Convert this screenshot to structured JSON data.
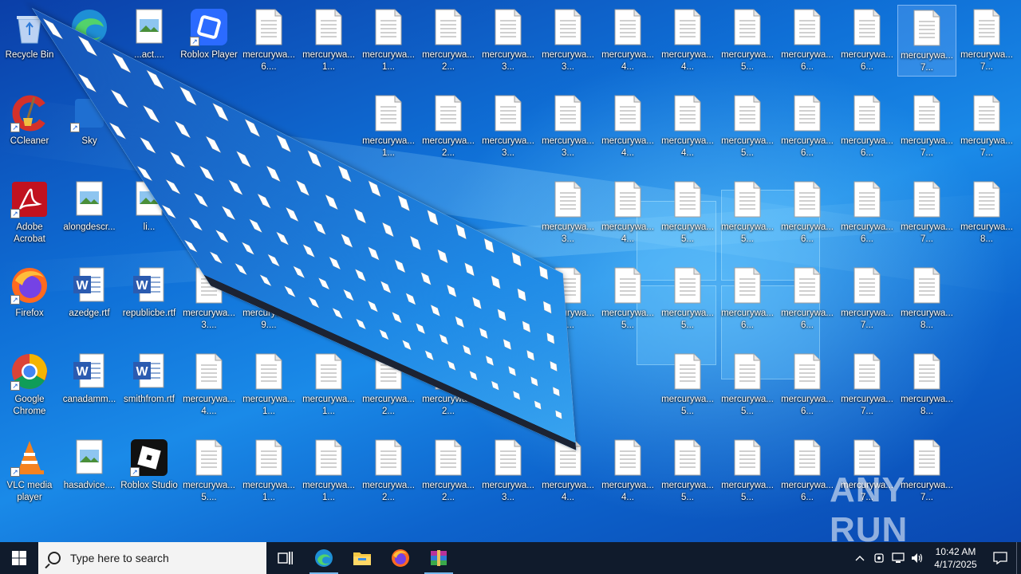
{
  "desktop": {
    "icons_col0": [
      {
        "label": "Recycle Bin",
        "type": "recycle"
      },
      {
        "label": "CCleaner",
        "type": "ccleaner"
      },
      {
        "label": "Adobe Acrobat",
        "type": "acrobat"
      },
      {
        "label": "Firefox",
        "type": "firefox"
      },
      {
        "label": "Google Chrome",
        "type": "chrome"
      },
      {
        "label": "VLC media player",
        "type": "vlc"
      }
    ],
    "icons_col1": [
      {
        "label": "",
        "type": "edge"
      },
      {
        "label": "Sky",
        "type": "generic"
      },
      {
        "label": "alongdescr...",
        "type": "image"
      },
      {
        "label": "azedge.rtf",
        "type": "word"
      },
      {
        "label": "canadamm...",
        "type": "word"
      },
      {
        "label": "hasadvice....",
        "type": "image"
      }
    ],
    "icons_col2": [
      {
        "label": "...act....",
        "type": "image"
      },
      {
        "label": "",
        "type": "none"
      },
      {
        "label": "li...",
        "type": "image"
      },
      {
        "label": "republicbe.rtf",
        "type": "word"
      },
      {
        "label": "smithfrom.rtf",
        "type": "word"
      },
      {
        "label": "Roblox Studio",
        "type": "roblox-studio"
      }
    ],
    "roblox_player_label": "Roblox Player",
    "doc_rows": [
      [
        "mercurywa... 6....",
        "mercurywa... 1...",
        "mercurywa... 1...",
        "mercurywa... 2...",
        "mercurywa... 3...",
        "mercurywa... 3...",
        "mercurywa... 4...",
        "mercurywa... 4...",
        "mercurywa... 5...",
        "mercurywa... 6...",
        "mercurywa... 6...",
        "mercurywa... 7...",
        "mercurywa... 7..."
      ],
      [
        "",
        "",
        "mercurywa... 1...",
        "mercurywa... 2...",
        "mercurywa... 3...",
        "mercurywa... 3...",
        "mercurywa... 4...",
        "mercurywa... 4...",
        "mercurywa... 5...",
        "mercurywa... 6...",
        "mercurywa... 6...",
        "mercurywa... 7...",
        "mercurywa... 7..."
      ],
      [
        "",
        "",
        "",
        "",
        "",
        "mercurywa... 3...",
        "mercurywa... 4...",
        "mercurywa... 5...",
        "mercurywa... 5...",
        "mercurywa... 6...",
        "mercurywa... 6...",
        "mercurywa... 7...",
        "mercurywa... 8..."
      ],
      [
        "mercurywa... 3....",
        "mercurywa... 9....",
        "",
        "",
        "",
        "",
        "mercurywa... 4...",
        "mercurywa... 5...",
        "mercurywa... 5...",
        "mercurywa... 6...",
        "mercurywa... 6...",
        "mercurywa... 7...",
        "mercurywa... 8..."
      ],
      [
        "mercurywa... 4....",
        "mercurywa... 1...",
        "mercurywa... 1...",
        "mercurywa... 2...",
        "mercurywa... 2...",
        "mercurywa... 3...",
        "",
        "",
        "mercurywa... 5...",
        "mercurywa... 5...",
        "mercurywa... 6...",
        "mercurywa... 7...",
        "mercurywa... 8..."
      ],
      [
        "mercurywa... 5....",
        "mercurywa... 1...",
        "mercurywa... 1...",
        "mercurywa... 2...",
        "mercurywa... 2...",
        "mercurywa... 3...",
        "mercurywa... 4...",
        "mercurywa... 4...",
        "mercurywa... 5...",
        "mercurywa... 5...",
        "mercurywa... 6...",
        "mercurywa... 7...",
        "mercurywa... 7..."
      ]
    ],
    "extra_last_row": "mercurywa... 8..."
  },
  "taskbar": {
    "search_placeholder": "Type here to search",
    "time": "10:42 AM",
    "date": "4/17/2025",
    "pinned": [
      "task-view",
      "edge",
      "file-explorer",
      "firefox",
      "winrar"
    ]
  },
  "watermark": "ANY RUN"
}
